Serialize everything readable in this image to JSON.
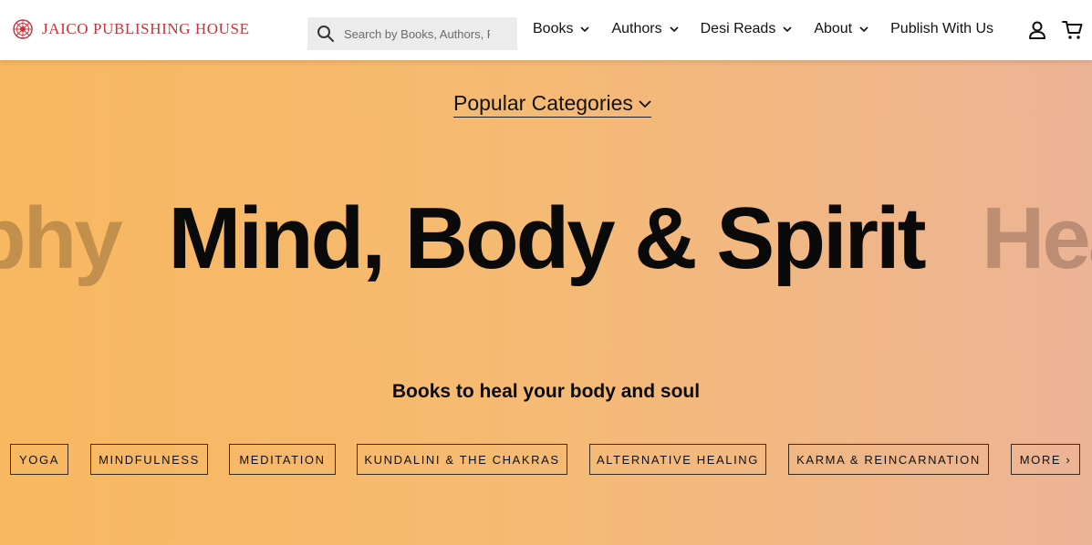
{
  "header": {
    "logo_text": "JAICO PUBLISHING HOUSE",
    "brand_color": "#c8323a",
    "search_placeholder": "Search by Books, Authors, P",
    "nav": [
      {
        "label": "Books",
        "has_dropdown": true
      },
      {
        "label": "Authors",
        "has_dropdown": true
      },
      {
        "label": "Desi Reads",
        "has_dropdown": true
      },
      {
        "label": "About",
        "has_dropdown": true
      },
      {
        "label": "Publish With Us",
        "has_dropdown": false
      }
    ],
    "icons": [
      "search-icon",
      "user-icon",
      "cart-icon"
    ]
  },
  "hero": {
    "dropdown_label": "Popular Categories",
    "prev_slide": "phy",
    "current_slide": "Mind, Body & Spirit",
    "next_slide": "Hea",
    "tagline": "Books to heal your body and soul",
    "gradient_colors": [
      "#f8b860",
      "#ecb496"
    ],
    "tags": [
      "YOGA",
      "MINDFULNESS",
      "MEDITATION",
      "KUNDALINI & THE CHAKRAS",
      "ALTERNATIVE HEALING",
      "KARMA & REINCARNATION",
      "MORE ›"
    ]
  }
}
